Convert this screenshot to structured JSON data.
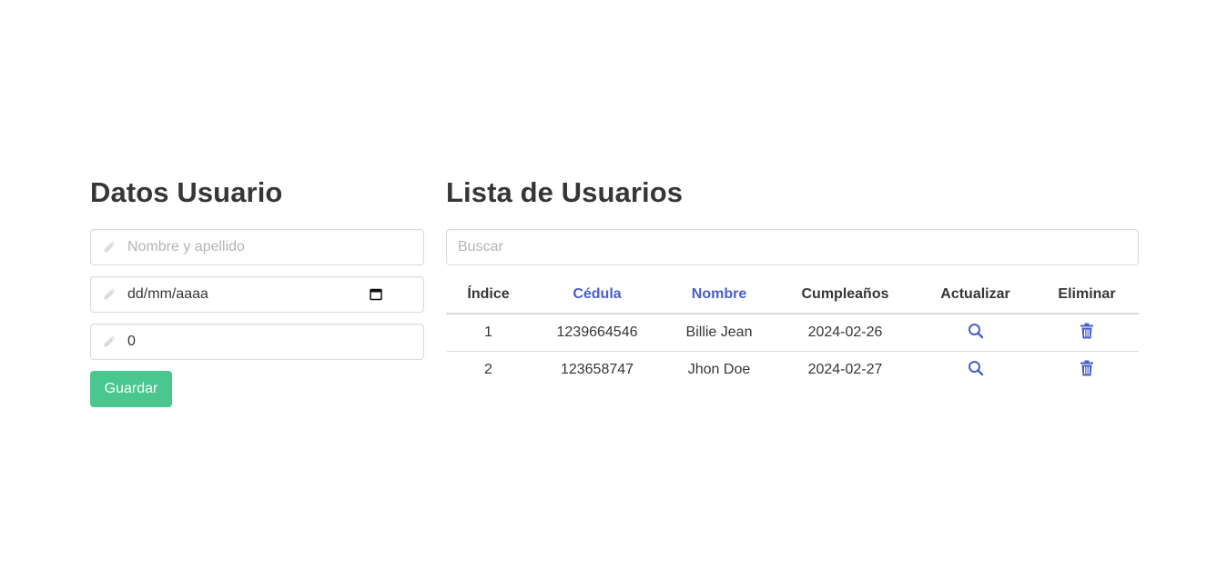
{
  "form": {
    "title": "Datos Usuario",
    "name_placeholder": "Nombre y apellido",
    "date_value": "dd/mm/aaaa",
    "number_value": "0",
    "save_label": "Guardar"
  },
  "list": {
    "title": "Lista de Usuarios",
    "search_placeholder": "Buscar",
    "columns": [
      "Índice",
      "Cédula",
      "Nombre",
      "Cumpleaños",
      "Actualizar",
      "Eliminar"
    ],
    "rows": [
      {
        "index": "1",
        "cedula": "1239664546",
        "nombre": "Billie Jean",
        "cumple": "2024-02-26"
      },
      {
        "index": "2",
        "cedula": "123658747",
        "nombre": "Jhon Doe",
        "cumple": "2024-02-27"
      }
    ]
  },
  "colors": {
    "primary": "#485fc7",
    "success": "#48c78e",
    "text": "#363636",
    "placeholder": "#b5b5b5",
    "border": "#dbdbdb"
  },
  "icons": {
    "field_icon": "pencil-icon",
    "update_icon": "search-icon",
    "delete_icon": "trash-icon",
    "date_icon": "calendar-icon"
  }
}
